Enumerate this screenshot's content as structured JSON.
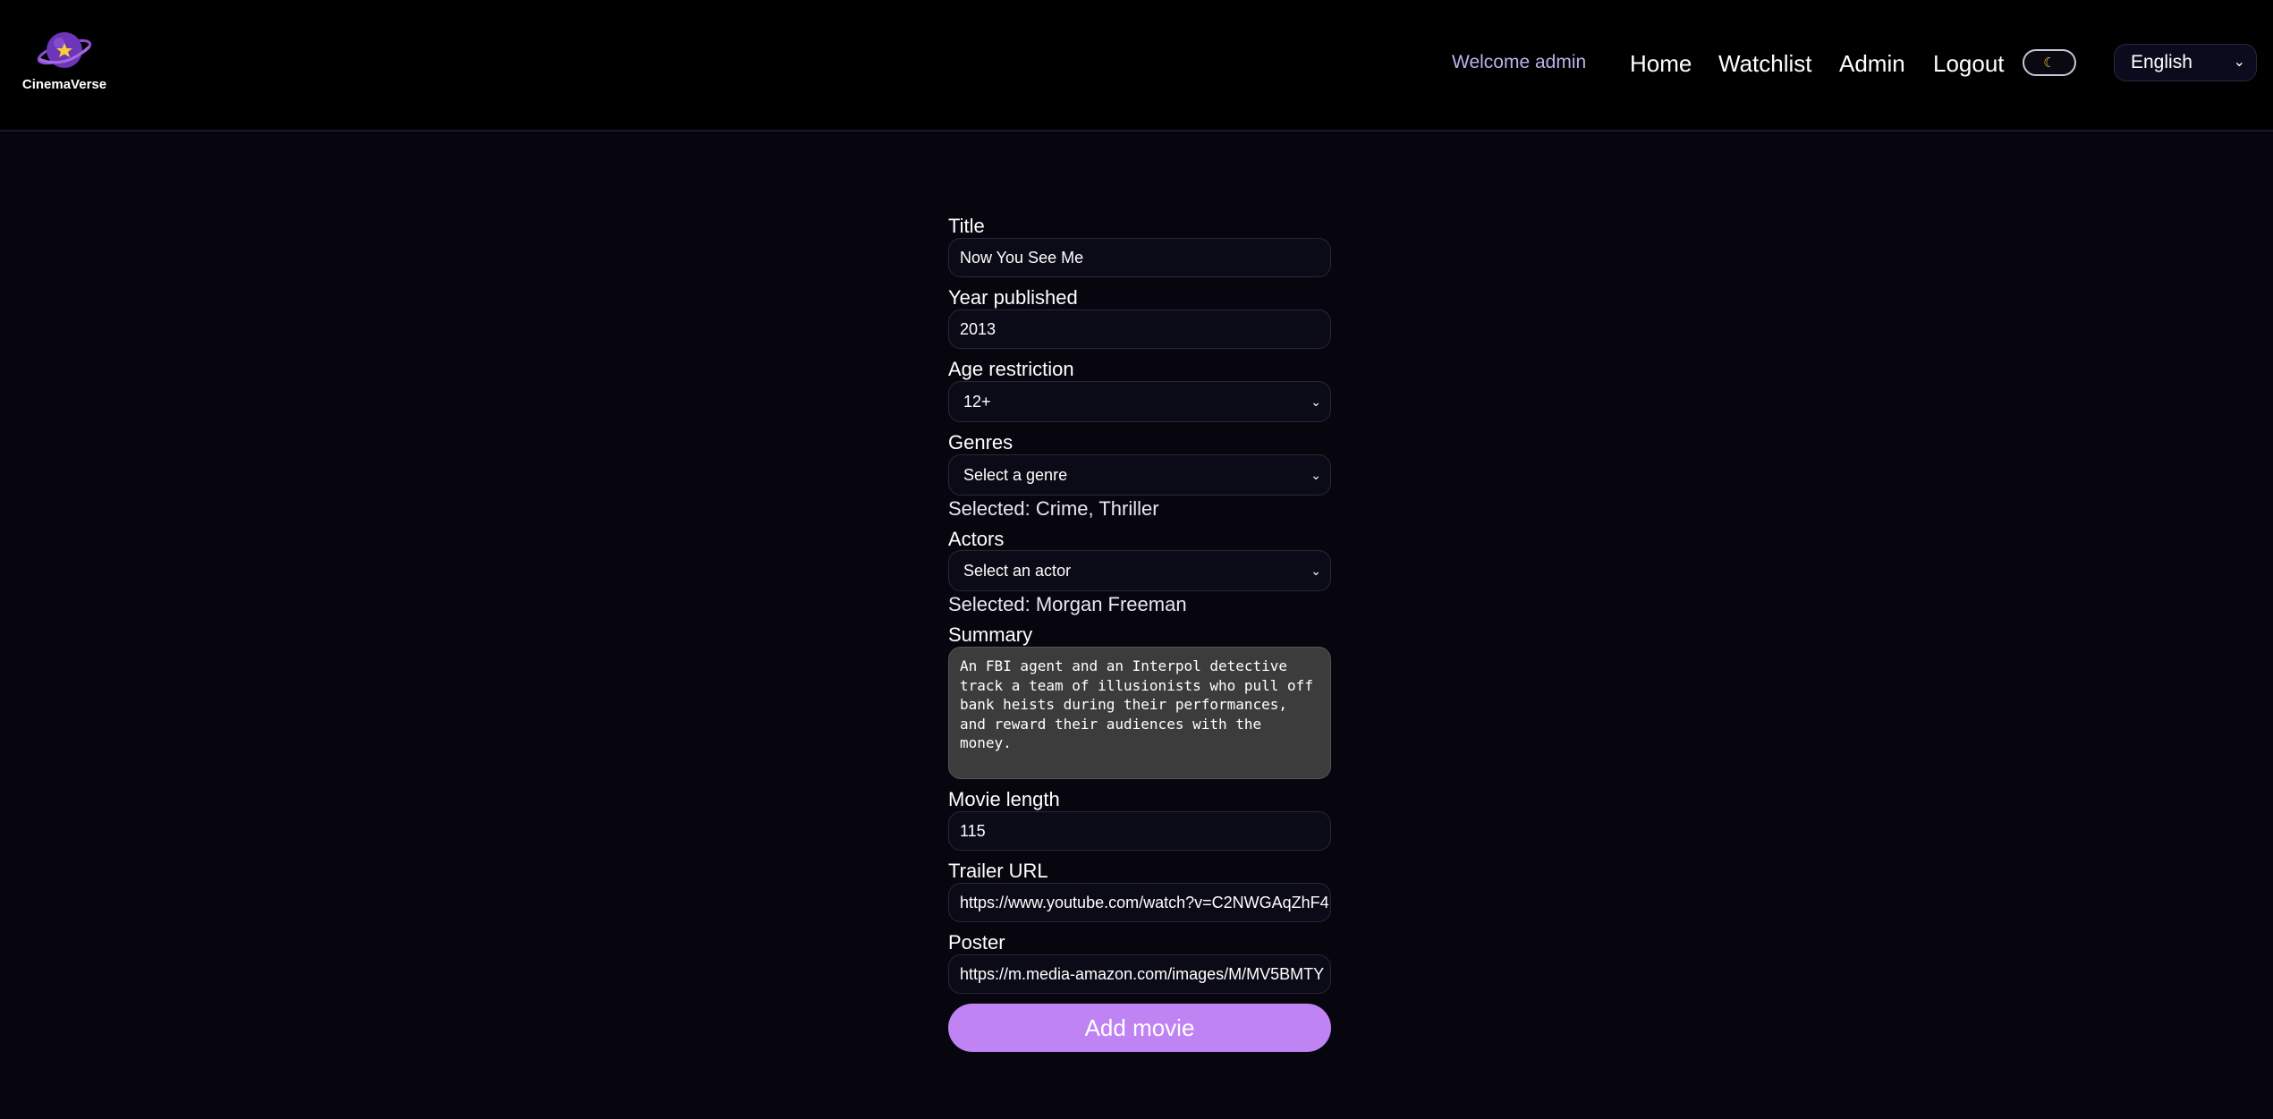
{
  "app": {
    "name": "CinemaVerse"
  },
  "header": {
    "welcome": "Welcome admin",
    "nav": [
      "Home",
      "Watchlist",
      "Admin",
      "Logout"
    ],
    "theme_icon": "moon-icon",
    "language": "English"
  },
  "form": {
    "title": {
      "label": "Title",
      "value": "Now You See Me"
    },
    "year": {
      "label": "Year published",
      "value": "2013"
    },
    "age": {
      "label": "Age restriction",
      "value": "12+"
    },
    "genres": {
      "label": "Genres",
      "placeholder": "Select a genre",
      "selected": "Selected: Crime, Thriller"
    },
    "actors": {
      "label": "Actors",
      "placeholder": "Select an actor",
      "selected": "Selected: Morgan Freeman"
    },
    "summary": {
      "label": "Summary",
      "value": "An FBI agent and an Interpol detective track a team of illusionists who pull off bank heists during their performances, and reward their audiences with the money."
    },
    "length": {
      "label": "Movie length",
      "value": "115"
    },
    "trailer": {
      "label": "Trailer URL",
      "value": "https://www.youtube.com/watch?v=C2NWGAqZhF4"
    },
    "poster": {
      "label": "Poster",
      "value": "https://m.media-amazon.com/images/M/MV5BMTY"
    },
    "submit_label": "Add movie"
  },
  "colors": {
    "accent": "#c083f4",
    "background": "#07060f",
    "header": "#000000"
  }
}
